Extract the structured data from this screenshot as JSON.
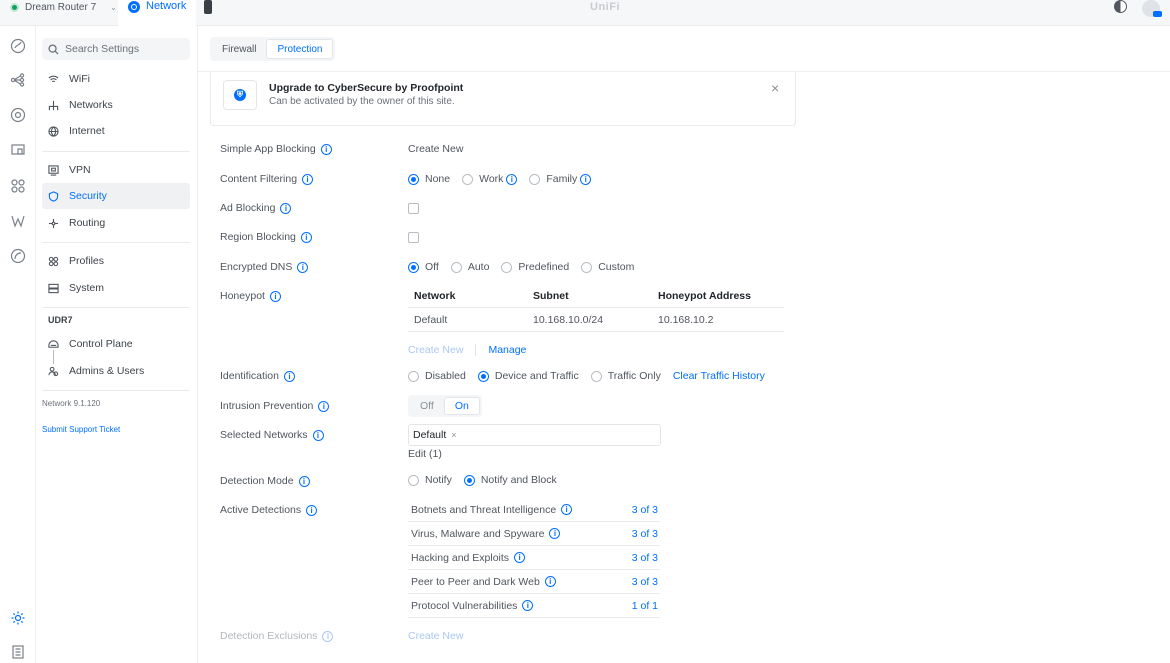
{
  "topbar": {
    "device_name": "Dream Router 7",
    "app_name": "Network",
    "brand": "UniFi"
  },
  "sidebar": {
    "search_placeholder": "Search Settings",
    "items": [
      {
        "label": "WiFi"
      },
      {
        "label": "Networks"
      },
      {
        "label": "Internet"
      },
      {
        "label": "VPN"
      },
      {
        "label": "Security"
      },
      {
        "label": "Routing"
      },
      {
        "label": "Profiles"
      },
      {
        "label": "System"
      }
    ],
    "group_label": "UDR7",
    "group_items": [
      {
        "label": "Control Plane"
      },
      {
        "label": "Admins & Users"
      }
    ],
    "version": "Network 9.1.120",
    "support_link": "Submit Support Ticket"
  },
  "tabs": [
    {
      "label": "Firewall",
      "active": false
    },
    {
      "label": "Protection",
      "active": true
    }
  ],
  "banner": {
    "title": "Upgrade to CyberSecure by Proofpoint",
    "subtitle": "Can be activated by the owner of this site.",
    "close": "×"
  },
  "settings": {
    "simple_app_blocking": {
      "label": "Simple App Blocking",
      "action": "Create New"
    },
    "content_filtering": {
      "label": "Content Filtering",
      "options": [
        "None",
        "Work",
        "Family"
      ],
      "selected": "None"
    },
    "ad_blocking": {
      "label": "Ad Blocking"
    },
    "region_blocking": {
      "label": "Region Blocking"
    },
    "encrypted_dns": {
      "label": "Encrypted DNS",
      "options": [
        "Off",
        "Auto",
        "Predefined",
        "Custom"
      ],
      "selected": "Off"
    },
    "honeypot": {
      "label": "Honeypot",
      "columns": [
        "Network",
        "Subnet",
        "Honeypot Address"
      ],
      "rows": [
        [
          "Default",
          "10.168.10.0/24",
          "10.168.10.2"
        ]
      ],
      "create_new": "Create New",
      "manage": "Manage"
    },
    "identification": {
      "label": "Identification",
      "options": [
        "Disabled",
        "Device and Traffic",
        "Traffic Only"
      ],
      "selected": "Device and Traffic",
      "action": "Clear Traffic History"
    },
    "intrusion_prevention": {
      "label": "Intrusion Prevention",
      "off": "Off",
      "on": "On",
      "selected": "On"
    },
    "selected_networks": {
      "label": "Selected Networks",
      "chip": "Default",
      "chip_remove": "×",
      "edit": "Edit (1)"
    },
    "detection_mode": {
      "label": "Detection Mode",
      "options": [
        "Notify",
        "Notify and Block"
      ],
      "selected": "Notify and Block"
    },
    "active_detections": {
      "label": "Active Detections",
      "rows": [
        {
          "name": "Botnets and Threat Intelligence",
          "count": "3 of 3"
        },
        {
          "name": "Virus, Malware and Spyware",
          "count": "3 of 3"
        },
        {
          "name": "Hacking and Exploits",
          "count": "3 of 3"
        },
        {
          "name": "Peer to Peer and Dark Web",
          "count": "3 of 3"
        },
        {
          "name": "Protocol Vulnerabilities",
          "count": "1 of 1"
        }
      ]
    },
    "detection_exclusions": {
      "label": "Detection Exclusions",
      "action": "Create New"
    }
  },
  "colors": {
    "accent": "#006fff",
    "text": "#50565e",
    "muted": "#b3b8be"
  }
}
